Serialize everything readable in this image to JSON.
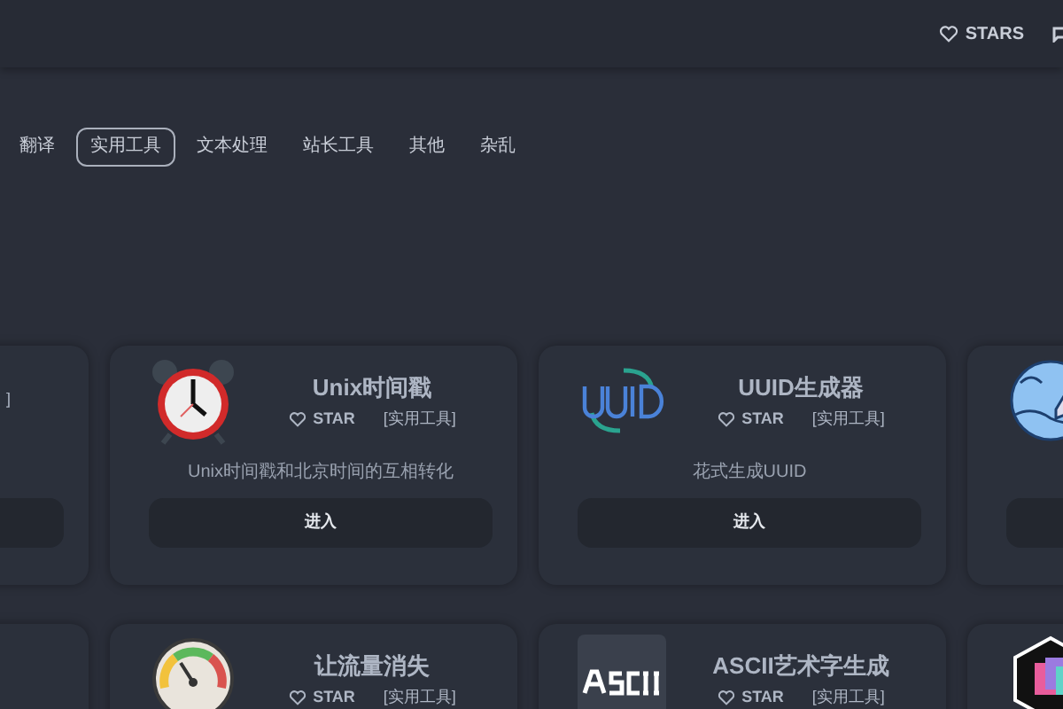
{
  "header": {
    "stars_label": "STARS"
  },
  "categories": [
    {
      "label": "翻译",
      "selected": false
    },
    {
      "label": "实用工具",
      "selected": true
    },
    {
      "label": "文本处理",
      "selected": false
    },
    {
      "label": "站长工具",
      "selected": false
    },
    {
      "label": "其他",
      "selected": false
    },
    {
      "label": "杂乱",
      "selected": false
    }
  ],
  "card_rows": [
    [
      {
        "tag": "]",
        "button": true
      },
      {
        "title": "Unix时间戳",
        "star": "STAR",
        "tag": "[实用工具]",
        "description": "Unix时间戳和北京时间的互相转化",
        "button": "进入"
      },
      {
        "title": "UUID生成器",
        "star": "STAR",
        "tag": "[实用工具]",
        "description": "花式生成UUID",
        "button": "进入"
      },
      {
        "button": true
      }
    ],
    [
      {},
      {
        "title": "让流量消失",
        "star": "STAR",
        "tag": "[实用工具]"
      },
      {
        "title": "ASCII艺术字生成",
        "star": "STAR",
        "tag": "[实用工具]"
      },
      {}
    ]
  ]
}
